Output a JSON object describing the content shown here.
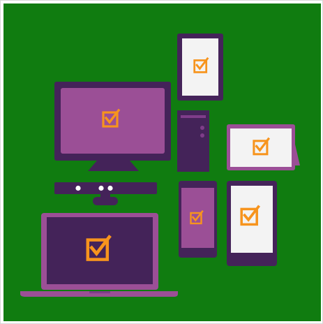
{
  "illustration": {
    "subject": "devices-with-checkmarks",
    "icon": "checkbox-checked-icon",
    "colors": {
      "background": "#107c10",
      "device_dark": "#442359",
      "device_purple": "#9b4f96",
      "device_purple_light": "#7f3d8a",
      "screen_light": "#f3f3f3",
      "check_orange": "#f7941d",
      "accent_white": "#ffffff"
    },
    "devices": [
      {
        "name": "desktop-monitor",
        "screen": "purple"
      },
      {
        "name": "desktop-tower",
        "screen": "none"
      },
      {
        "name": "kinect-sensor",
        "screen": "none"
      },
      {
        "name": "laptop",
        "screen": "dark"
      },
      {
        "name": "tablet-portrait",
        "screen": "light"
      },
      {
        "name": "tablet-landscape",
        "screen": "light"
      },
      {
        "name": "phone",
        "screen": "purple"
      },
      {
        "name": "tablet-small",
        "screen": "light"
      }
    ]
  }
}
